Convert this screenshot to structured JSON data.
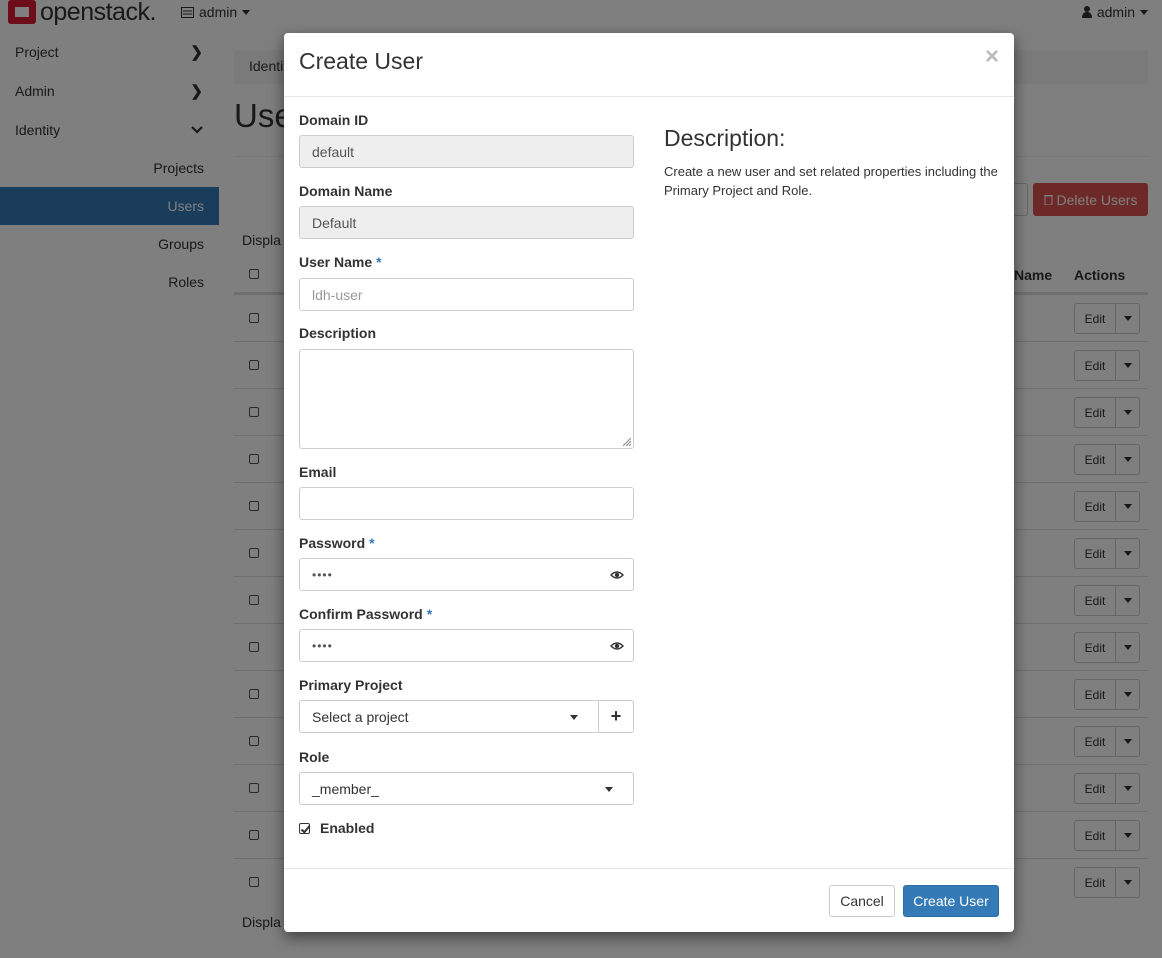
{
  "navbar": {
    "brand": "openstack.",
    "project_selector": "admin",
    "user_menu": "admin"
  },
  "sidebar": {
    "items": [
      {
        "label": "Project"
      },
      {
        "label": "Admin"
      },
      {
        "label": "Identity"
      }
    ],
    "identity_subitems": [
      {
        "label": "Projects"
      },
      {
        "label": "Users"
      },
      {
        "label": "Groups"
      },
      {
        "label": "Roles"
      }
    ]
  },
  "page": {
    "breadcrumb": "Identit",
    "title": "Use",
    "delete_button": "Delete Users",
    "display_top": "Displa",
    "display_bottom": "Displa",
    "col_name_fragment": "Name",
    "col_actions": "Actions",
    "row_edit_label": "Edit"
  },
  "modal": {
    "title": "Create User",
    "close": "×",
    "fields": {
      "domain_id": {
        "label": "Domain ID",
        "value": "default"
      },
      "domain_name": {
        "label": "Domain Name",
        "value": "Default"
      },
      "user_name": {
        "label": "User Name",
        "required": "*",
        "placeholder": "ldh-user"
      },
      "description": {
        "label": "Description",
        "value": ""
      },
      "email": {
        "label": "Email",
        "value": ""
      },
      "password": {
        "label": "Password",
        "required": "*",
        "value": "••••"
      },
      "confirm_password": {
        "label": "Confirm Password",
        "required": "*",
        "value": "••••"
      },
      "primary_project": {
        "label": "Primary Project",
        "value": "Select a project",
        "add": "+"
      },
      "role": {
        "label": "Role",
        "value": "_member_"
      },
      "enabled": {
        "label": "Enabled",
        "checked": true
      }
    },
    "help": {
      "heading": "Description:",
      "text": "Create a new user and set related properties including the Primary Project and Role."
    },
    "footer": {
      "cancel": "Cancel",
      "submit": "Create User"
    }
  },
  "colors": {
    "primary": "#337ab7",
    "danger": "#d9534f",
    "logo_red": "#da1a32"
  }
}
